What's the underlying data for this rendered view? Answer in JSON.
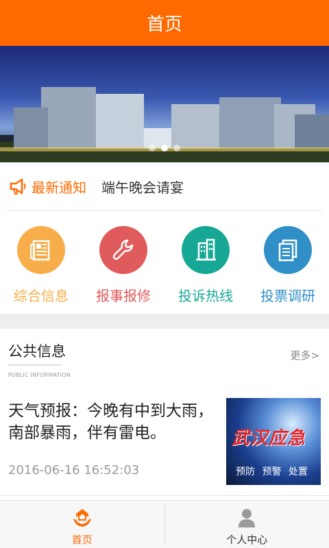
{
  "header": {
    "title": "首页"
  },
  "banner": {
    "slides": 3,
    "active_slide": 1
  },
  "notice": {
    "label": "最新通知",
    "text": "端午晚会请宴"
  },
  "grid": {
    "items": [
      {
        "label": "综合信息",
        "color": "#f7ae4a",
        "icon": "newspaper-icon"
      },
      {
        "label": "报事报修",
        "color": "#e05b5b",
        "icon": "wrench-icon"
      },
      {
        "label": "投诉热线",
        "color": "#16a895",
        "icon": "building-icon"
      },
      {
        "label": "投票调研",
        "color": "#2f8fc6",
        "icon": "document-icon"
      }
    ]
  },
  "section": {
    "title": "公共信息",
    "subtitle": "PUBLIC INFORMATION",
    "more": "更多>"
  },
  "news": {
    "title": "天气预报：今晚有中到大雨，南部暴雨，伴有雷电。",
    "date": "2016-06-16 16:52:03",
    "thumb_title": "武汉应急",
    "thumb_sub": "预防 预警 处置"
  },
  "tabbar": {
    "items": [
      {
        "label": "首页",
        "active": true,
        "color": "#ff6a00"
      },
      {
        "label": "个人中心",
        "active": false,
        "color": "#333333"
      }
    ]
  }
}
